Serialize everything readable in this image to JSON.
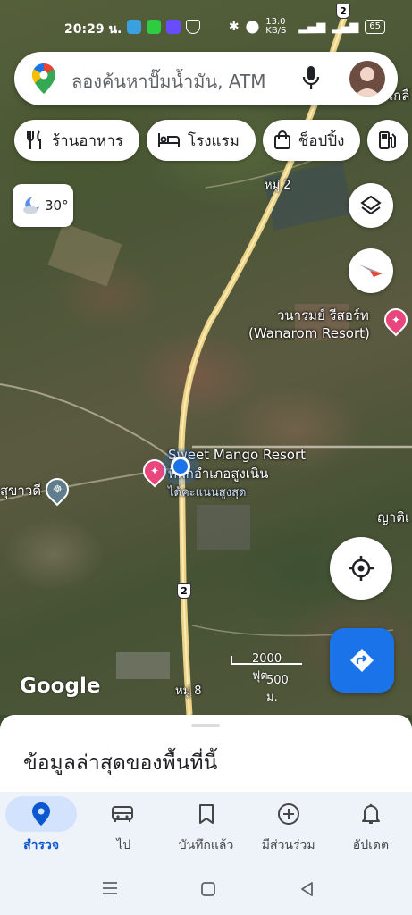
{
  "status_bar": {
    "time": "20:29 น.",
    "net_speed": "13.0 KB/S",
    "battery": "65"
  },
  "search": {
    "placeholder": "ลองค้นหาปั๊มน้ำมัน, ATM"
  },
  "chips": [
    {
      "label": "ร้านอาหาร",
      "icon": "restaurant-icon"
    },
    {
      "label": "โรงแรม",
      "icon": "hotel-icon"
    },
    {
      "label": "ช็อปปิ้ง",
      "icon": "shopping-bag-icon"
    },
    {
      "label": "",
      "icon": "gas-station-icon"
    }
  ],
  "weather": {
    "temp": "30°"
  },
  "map": {
    "labels": {
      "village_top": "หมู่ 2",
      "village_bottom": "หมู่ 8",
      "wanarom_th": "วนารมย์ รีสอร์ท",
      "wanarom_en": "(Wanarom Resort)",
      "sweet_mango": "Sweet Mango Resort",
      "district": "ที่พักอำเภอสูงเนิน",
      "district_sub": "ได้คะแนนสูงสุด",
      "left_place": "สุขาวดี",
      "right_place": "ญาติเ",
      "top_right": "เกลื",
      "route": "2"
    }
  },
  "scale": {
    "feet": "2000 ฟุต",
    "meters": "500 ม."
  },
  "google_logo": "Google",
  "sheet": {
    "title": "ข้อมูลล่าสุดของพื้นที่นี้"
  },
  "nav": [
    {
      "label": "สำรวจ",
      "icon": "explore-pin-icon",
      "active": true
    },
    {
      "label": "ไป",
      "icon": "car-icon",
      "active": false
    },
    {
      "label": "บันทึกแล้ว",
      "icon": "bookmark-icon",
      "active": false
    },
    {
      "label": "มีส่วนร่วม",
      "icon": "add-circle-icon",
      "active": false
    },
    {
      "label": "อัปเดต",
      "icon": "bell-icon",
      "active": false
    }
  ],
  "colors": {
    "accent": "#1a73e8",
    "poi_pink": "#e8467c",
    "poi_gray": "#5f7d8c"
  }
}
